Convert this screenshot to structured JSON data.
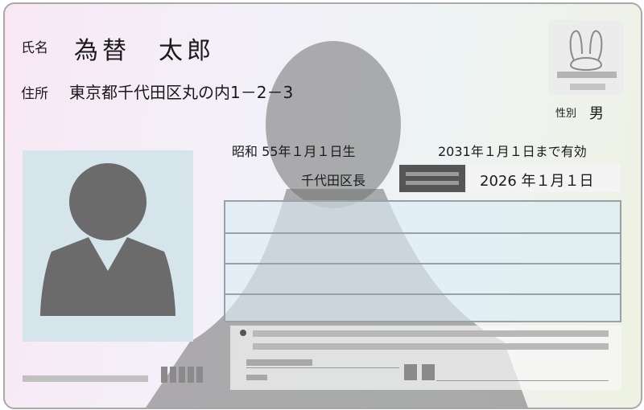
{
  "card": {
    "name_label": "氏名",
    "name_value": "為替　太郎",
    "address_label": "住所",
    "address_value": "東京都千代田区丸の内1－2－3",
    "sex_label": "性別",
    "sex_value": "男",
    "birth_date": "昭和 55年１月１日生",
    "valid_until": "2031年１月１日まで有効",
    "issuer": "千代田区長",
    "issue_date": "2026 年１月１日"
  },
  "icons": {
    "mascot": "rabbit-icon",
    "photo": "person-silhouette-icon"
  }
}
